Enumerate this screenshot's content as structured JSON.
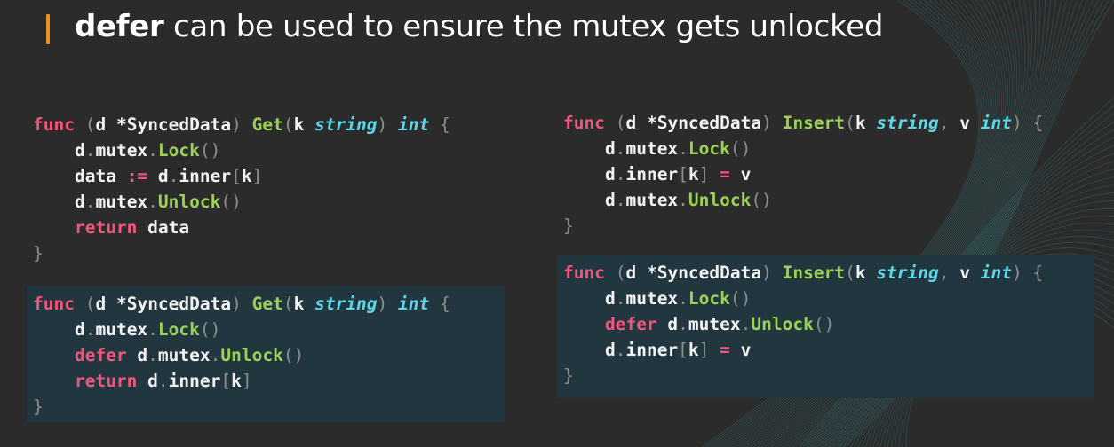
{
  "slide": {
    "title_keyword": "defer",
    "title_rest": " can be used to ensure the mutex gets unlocked"
  },
  "code": {
    "receiver_type": "*SyncedData",
    "get_name": "Get",
    "insert_name": "Insert",
    "param_k": "k",
    "param_v": "v",
    "type_string": "string",
    "type_int": "int",
    "kw_func": "func",
    "kw_return": "return",
    "kw_defer": "defer",
    "recv": "d",
    "mutex": "mutex",
    "inner": "inner",
    "lock": "Lock",
    "unlock": "Unlock",
    "var_data": "data",
    "op_assign": ":=",
    "op_eq": "="
  },
  "colors": {
    "accent": "#e8932a",
    "background": "#2b2b2b",
    "highlight_box": "#223640",
    "keyword": "#f2557c",
    "type": "#5fd6e6",
    "function": "#9ad156"
  }
}
